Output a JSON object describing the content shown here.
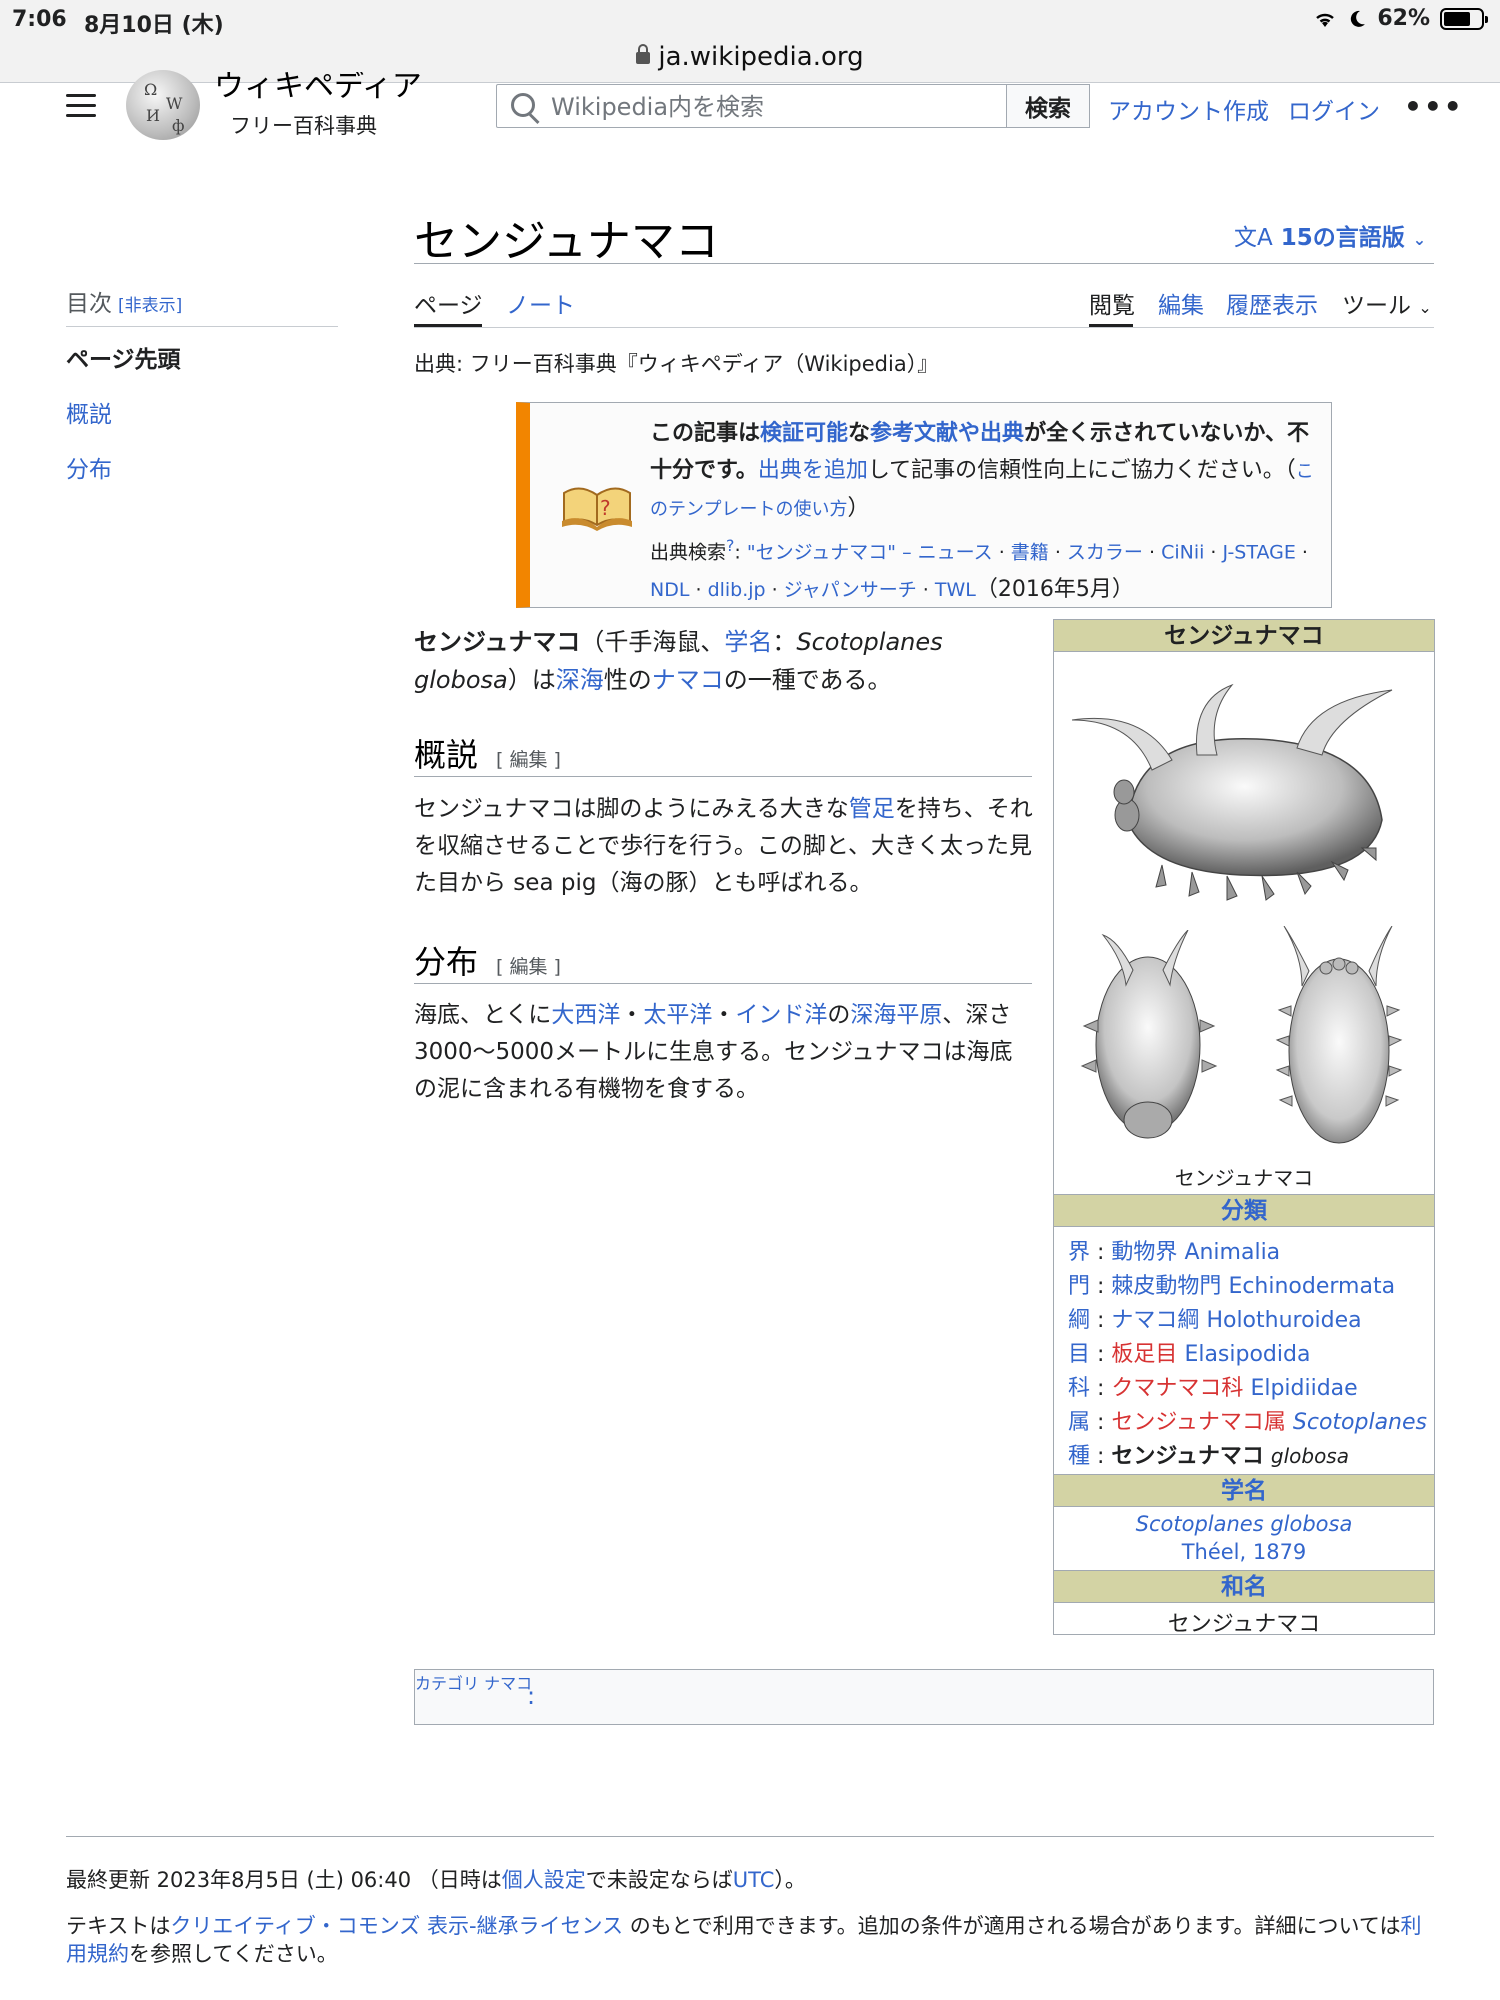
{
  "status": {
    "time": "7:06",
    "date": "8月10日 (木)",
    "battery": "62%",
    "url": "ja.wikipedia.org"
  },
  "header": {
    "wordmark": "ウィキペディア",
    "tagline": "フリー百科事典",
    "search_placeholder": "Wikipedia内を検索",
    "search_button": "検索",
    "create_account": "アカウント作成",
    "login": "ログイン",
    "more": "•••"
  },
  "toc": {
    "title": "目次",
    "hide": "[非表示]",
    "items": [
      "ページ先頭",
      "概説",
      "分布"
    ]
  },
  "page": {
    "title": "センジュナマコ",
    "languages": "15の言語版",
    "tabs_left": [
      "ページ",
      "ノート"
    ],
    "tabs_right": [
      "閲覧",
      "編集",
      "履歴表示",
      "ツール"
    ],
    "source": "出典: フリー百科事典『ウィキペディア（Wikipedia）』"
  },
  "ambox": {
    "b1": "この記事は",
    "l1": "検証可能",
    "b2": "な",
    "l2": "参考文献や出典",
    "b3": "が全く示されていないか、不十分です。",
    "l3": "出典を追加",
    "t1": "して記事の信頼性向上にご協力ください。（",
    "l4": "このテンプレートの使い方",
    "t2": "）",
    "search_label": "出典検索",
    "search_q": "?",
    "search_colon": ": ",
    "links": [
      "\"センジュナマコ\" – ニュース",
      "書籍",
      "スカラー",
      "CiNii",
      "J-STAGE",
      "NDL",
      "dlib.jp",
      "ジャパンサーチ",
      "TWL"
    ],
    "date": "（2016年5月）"
  },
  "lead": {
    "bold": "センジュナマコ",
    "t1": "（千手海鼠、",
    "l1": "学名",
    "t2": "：",
    "italic": "Scotoplanes globosa",
    "t3": "）は",
    "l2": "深海",
    "t4": "性の",
    "l3": "ナマコ",
    "t5": "の一種である。"
  },
  "sections": [
    {
      "heading": "概説",
      "edit": "[ 編集 ]",
      "t1": "センジュナマコは脚のようにみえる大きな",
      "l1": "管足",
      "t2": "を持ち、それを収縮させることで歩行を行う。この脚と、大きく太った見た目から sea pig（海の豚）とも呼ばれる。"
    },
    {
      "heading": "分布",
      "edit": "[ 編集 ]",
      "t1": "海底、とくに",
      "l1": "大西洋",
      "s1": "・",
      "l2": "太平洋",
      "s2": "・",
      "l3": "インド洋",
      "t2": "の",
      "l4": "深海平原",
      "t3": "、深さ3000〜5000メートルに生息する。センジュナマコは海底の泥に含まれる有機物を食する。"
    }
  ],
  "infobox": {
    "title": "センジュナマコ",
    "caption": "センジュナマコ",
    "classification_header": "分類",
    "taxa": [
      {
        "rank": "界",
        "name": "動物界",
        "latin": "Animalia",
        "red": false
      },
      {
        "rank": "門",
        "name": "棘皮動物門",
        "latin": "Echinodermata",
        "red": false
      },
      {
        "rank": "綱",
        "name": "ナマコ綱",
        "latin": "Holothuroidea",
        "red": false
      },
      {
        "rank": "目",
        "name": "板足目",
        "latin": "Elasipodida",
        "red": true
      },
      {
        "rank": "科",
        "name": "クマナマコ科",
        "latin": "Elpidiidae",
        "red": true
      },
      {
        "rank": "属",
        "name": "センジュナマコ属",
        "latin": "Scotoplanes",
        "red": true
      },
      {
        "rank": "種",
        "name": "センジュナマコ",
        "latin": "globosa",
        "red": false
      }
    ],
    "sciname_header": "学名",
    "sciname": "Scotoplanes globosa",
    "author": "Théel",
    "author_year": ", 1879",
    "japname_header": "和名",
    "japname": "センジュナマコ"
  },
  "categories": {
    "label": "カテゴリ",
    "colon": ":",
    "item": "ナマコ"
  },
  "footer": {
    "updated_prefix": "最終更新 2023年8月5日 (土) 06:40 （日時は",
    "updated_link1": "個人設定",
    "updated_mid": "で未設定ならば",
    "updated_link2": "UTC",
    "updated_suffix": "）。",
    "license_prefix": "テキストは",
    "license_link": "クリエイティブ・コモンズ 表示-継承ライセンス",
    "license_mid": " のもとで利用できます。追加の条件が適用される場合があります。詳細については",
    "license_link2": "利用規約",
    "license_suffix": "を参照してください。"
  }
}
